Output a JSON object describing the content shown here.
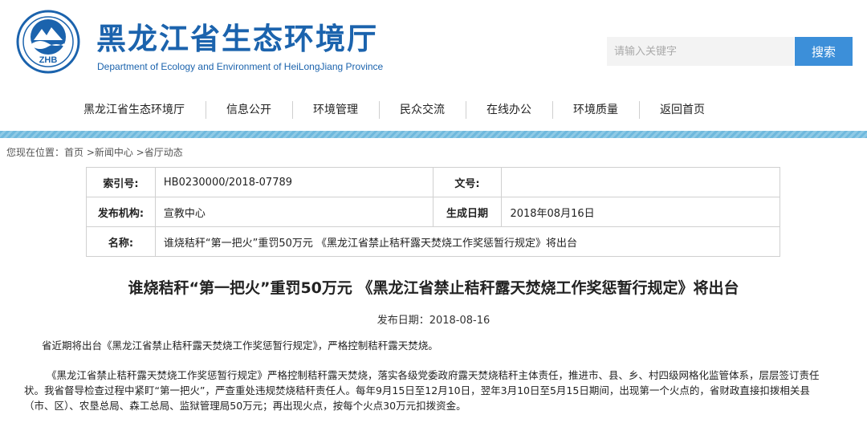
{
  "header": {
    "logo_text": "ZHB",
    "title": "黑龙江省生态环境厅",
    "subtitle": "Department of Ecology and Environment  of HeiLongJiang Province"
  },
  "search": {
    "placeholder": "请输入关键字",
    "button_label": "搜索"
  },
  "nav": {
    "items": [
      "黑龙江省生态环境厅",
      "信息公开",
      "环境管理",
      "民众交流",
      "在线办公",
      "环境质量",
      "返回首页"
    ]
  },
  "breadcrumb": "您现在位置：首页 >新闻中心 >省厅动态",
  "info": {
    "index_label": "索引号:",
    "index_value": "HB0230000/2018-07789",
    "docno_label": "文号:",
    "docno_value": "",
    "publisher_label": "发布机构:",
    "publisher_value": "宣教中心",
    "gendate_label": "生成日期",
    "gendate_value": "2018年08月16日",
    "name_label": "名称:",
    "name_value": "谁烧秸秆“第一把火”重罚50万元 《黑龙江省禁止秸秆露天焚烧工作奖惩暂行规定》将出台"
  },
  "article": {
    "title": "谁烧秸秆“第一把火”重罚50万元 《黑龙江省禁止秸秆露天焚烧工作奖惩暂行规定》将出台",
    "date": "发布日期：2018-08-16",
    "para1": "省近期将出台《黑龙江省禁止秸秆露天焚烧工作奖惩暂行规定》，严格控制秸秆露天焚烧。",
    "para2": "《黑龙江省禁止秸秆露天焚烧工作奖惩暂行规定》严格控制秸秆露天焚烧，落实各级党委政府露天焚烧秸秆主体责任，推进市、县、乡、村四级网格化监管体系，层层签订责任状。我省督导检查过程中紧盯“第一把火”，严查重处违规焚烧秸秆责任人。每年9月15日至12月10日，翌年3月10日至5月15日期间，出现第一个火点的，省财政直接扣拨相关县（市、区）、农垦总局、森工总局、监狱管理局50万元；再出现火点，按每个火点30万元扣拨资金。"
  },
  "colors": {
    "brand_blue": "#1b63ad",
    "button_blue": "#3c8fd9",
    "strip_blue": "#7cc0e0"
  }
}
